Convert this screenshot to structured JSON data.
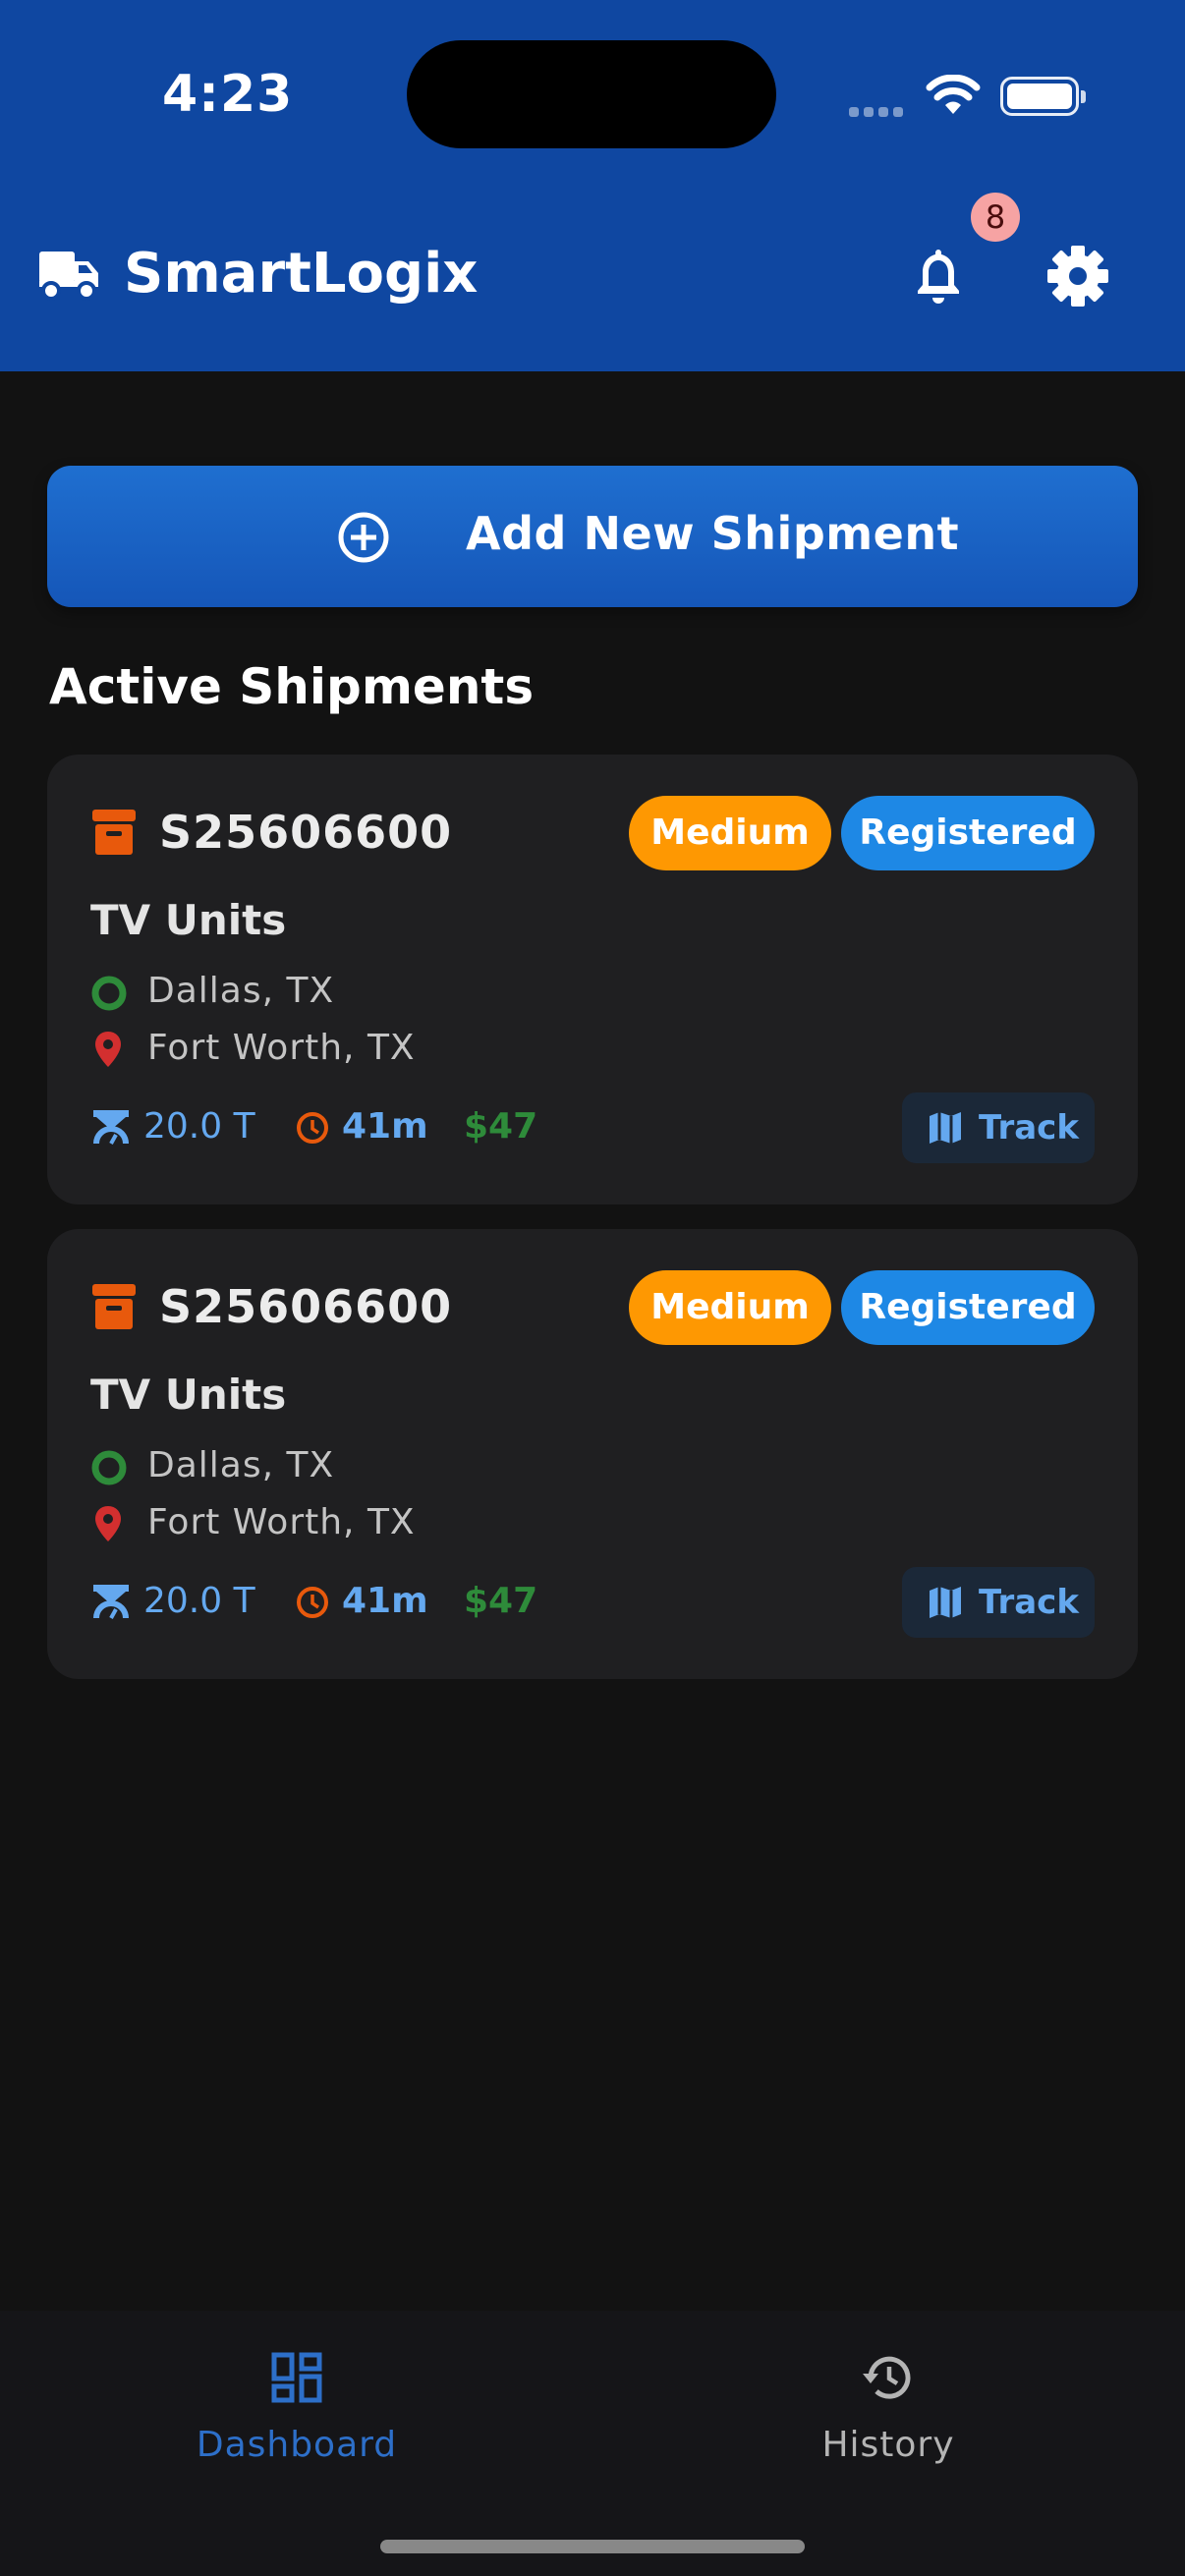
{
  "status_bar": {
    "time": "4:23"
  },
  "header": {
    "title": "SmartLogix",
    "notification_count": "8",
    "icons": {
      "logo": "truck-icon",
      "notifications": "bell-icon",
      "settings": "gear-icon"
    }
  },
  "actions": {
    "add_shipment_label": "Add New Shipment"
  },
  "section": {
    "title": "Active Shipments"
  },
  "shipments": [
    {
      "id": "S25606600",
      "priority": "Medium",
      "status": "Registered",
      "cargo": "TV Units",
      "origin": "Dallas, TX",
      "destination": "Fort Worth, TX",
      "weight": "20.0 T",
      "eta": "41m",
      "price": "$47",
      "track_label": "Track"
    },
    {
      "id": "S25606600",
      "priority": "Medium",
      "status": "Registered",
      "cargo": "TV Units",
      "origin": "Dallas, TX",
      "destination": "Fort Worth, TX",
      "weight": "20.0 T",
      "eta": "41m",
      "price": "$47",
      "track_label": "Track"
    }
  ],
  "nav": {
    "dashboard_label": "Dashboard",
    "history_label": "History",
    "active": "Dashboard"
  },
  "colors": {
    "header": "#0f47a1",
    "background": "#121212",
    "card": "#1f1f21",
    "priority_medium": "#fe9802",
    "status_registered": "#1e88e5",
    "accent_blue": "#64a8ef",
    "price_green": "#2e8b3a",
    "box_orange": "#e8590c",
    "pin_red": "#d32f2f"
  }
}
